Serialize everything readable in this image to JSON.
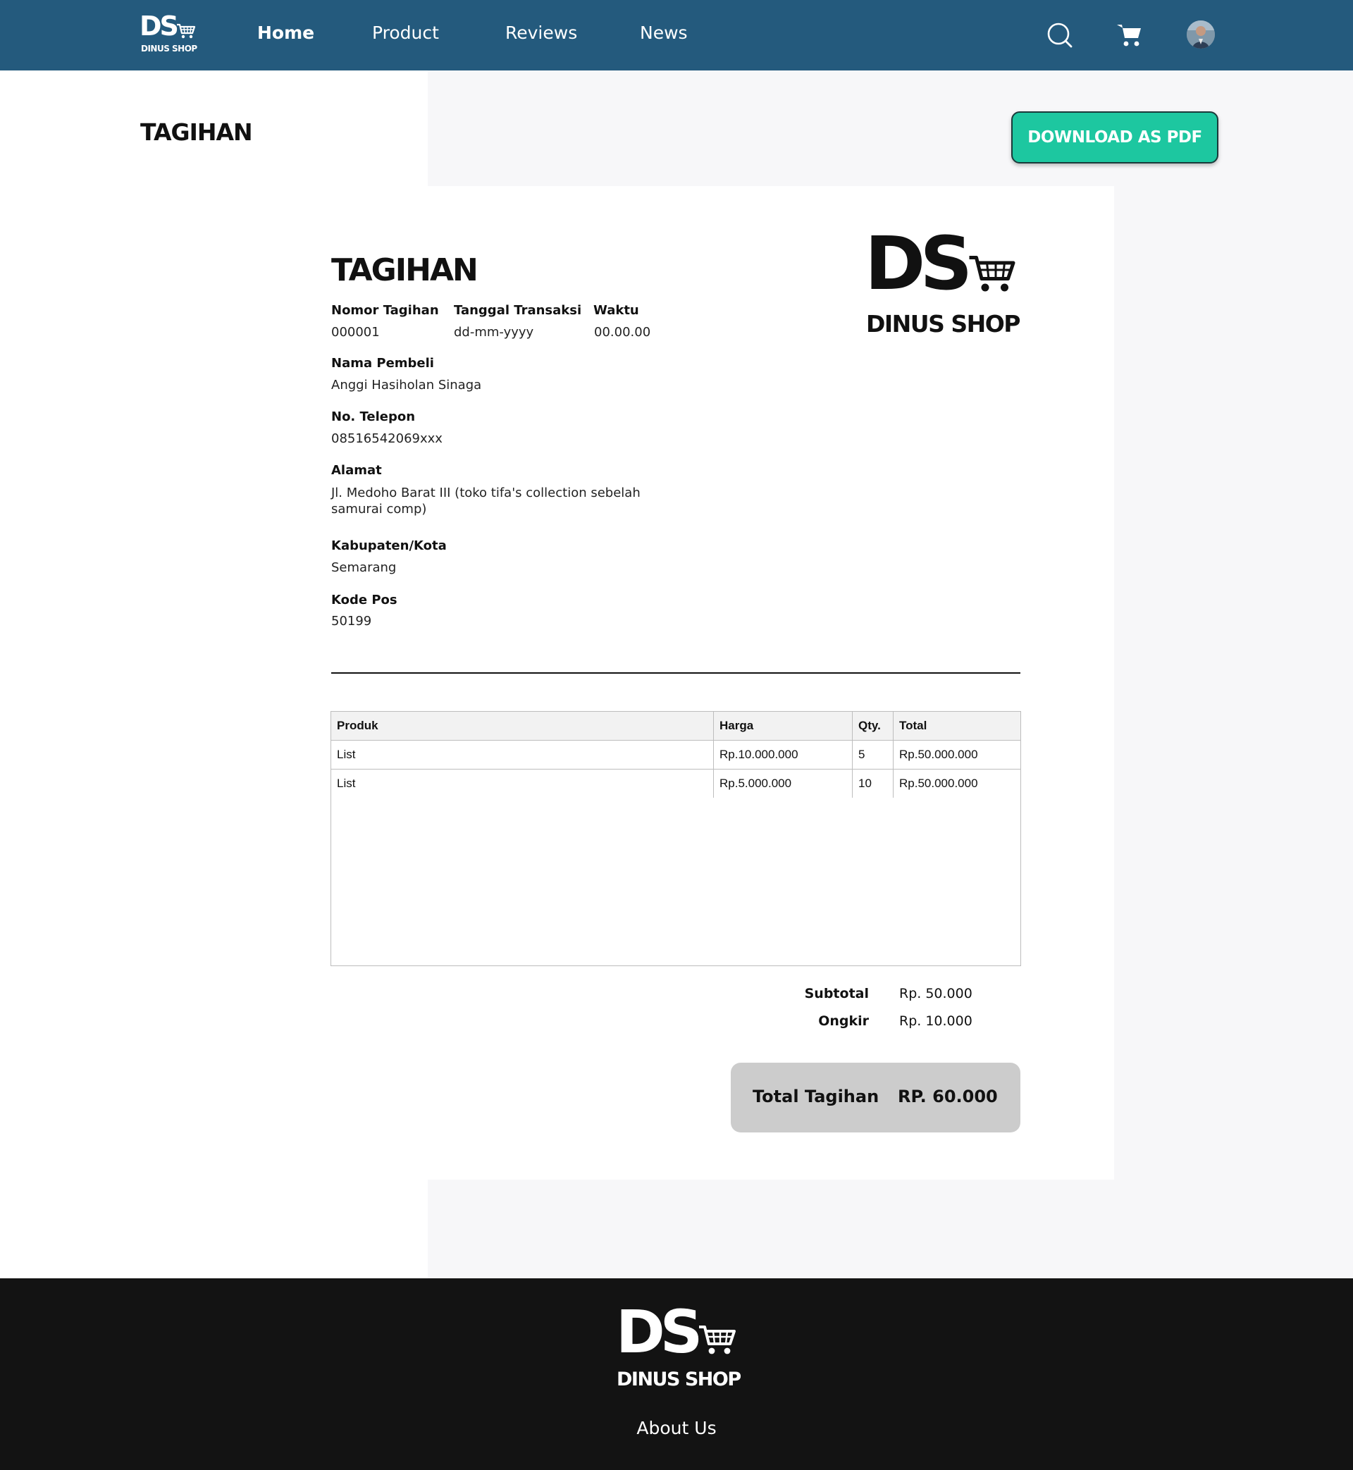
{
  "brand": {
    "initials": "DS",
    "name": "DINUS SHOP"
  },
  "nav": {
    "links": [
      "Home",
      "Product",
      "Reviews",
      "News"
    ],
    "active": "Home",
    "icons": [
      "search-icon",
      "cart-icon",
      "avatar"
    ]
  },
  "page": {
    "title": "TAGIHAN",
    "download_label": "DOWNLOAD AS PDF"
  },
  "invoice": {
    "title": "TAGIHAN",
    "fields": {
      "nomor_label": "Nomor Tagihan",
      "nomor_value": "000001",
      "tanggal_label": "Tanggal Transaksi",
      "tanggal_value": "dd-mm-yyyy",
      "waktu_label": "Waktu",
      "waktu_value": "00.00.00",
      "nama_label": "Nama Pembeli",
      "nama_value": "Anggi Hasiholan Sinaga",
      "telepon_label": "No. Telepon",
      "telepon_value": "08516542069xxx",
      "alamat_label": "Alamat",
      "alamat_value": "Jl. Medoho Barat III (toko tifa's collection sebelah samurai comp)",
      "kota_label": "Kabupaten/Kota",
      "kota_value": "Semarang",
      "kodepos_label": "Kode Pos",
      "kodepos_value": "50199"
    },
    "table": {
      "headers": [
        "Produk",
        "Harga",
        "Qty.",
        "Total"
      ],
      "rows": [
        [
          "List",
          "Rp.10.000.000",
          "5",
          "Rp.50.000.000"
        ],
        [
          "List",
          "Rp.5.000.000",
          "10",
          "Rp.50.000.000"
        ]
      ]
    },
    "summary": {
      "subtotal_label": "Subtotal",
      "subtotal_value": "Rp. 50.000",
      "ongkir_label": "Ongkir",
      "ongkir_value": "Rp. 10.000",
      "total_label": "Total Tagihan",
      "total_value": "RP. 60.000"
    }
  },
  "footer": {
    "about": "About Us"
  },
  "colors": {
    "navbar": "#245a7d",
    "accent": "#1dc7a0",
    "footer": "#131313",
    "total_box": "#cccccc",
    "page_gray": "#f7f7f9"
  }
}
